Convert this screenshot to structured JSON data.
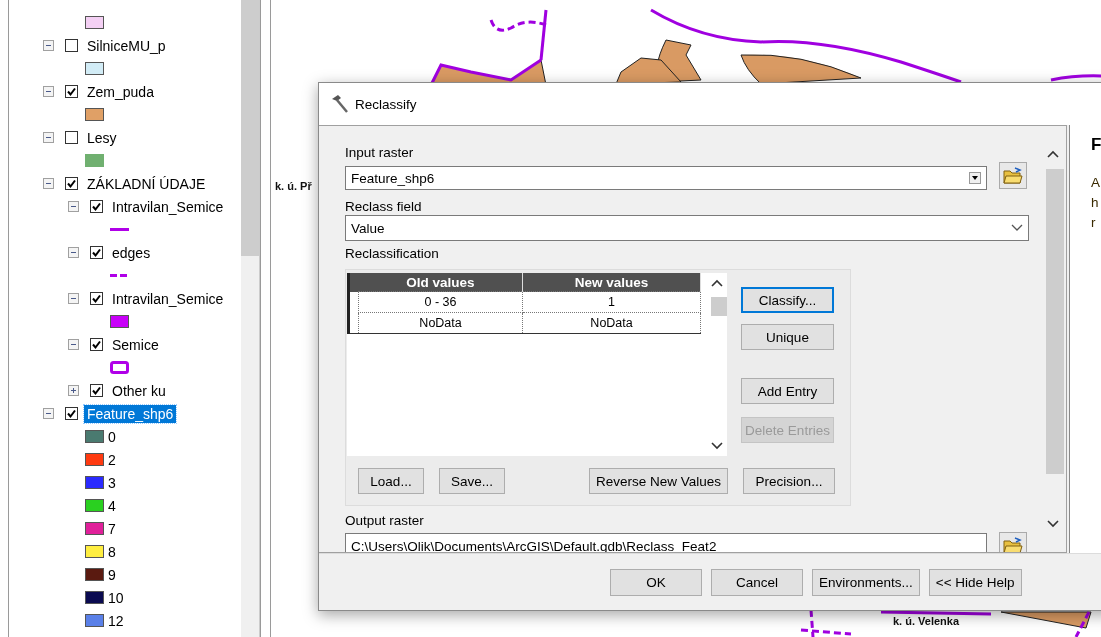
{
  "toc": {
    "top_legend": {
      "kind": "fill",
      "color": "#f4d0f4"
    },
    "layers": [
      {
        "name": "SilniceMU_p",
        "checked": false,
        "expanded": true,
        "selected": false,
        "symbol": {
          "kind": "fill",
          "color": "#d2ecf6"
        }
      },
      {
        "name": "Zem_puda",
        "checked": true,
        "expanded": true,
        "selected": false,
        "symbol": {
          "kind": "fill",
          "color": "#e0a066"
        }
      },
      {
        "name": "Lesy",
        "checked": false,
        "expanded": true,
        "selected": false,
        "symbol": {
          "kind": "flat",
          "color": "#70b070"
        }
      },
      {
        "name": "ZÁKLADNÍ ÚDAJE",
        "checked": true,
        "expanded": true,
        "selected": false,
        "children": [
          {
            "name": "Intravilan_Semice",
            "checked": true,
            "expanded": true,
            "selected": false,
            "symbol": {
              "kind": "line",
              "color": "#b000e8"
            }
          },
          {
            "name": "edges",
            "checked": true,
            "expanded": true,
            "selected": false,
            "symbol": {
              "kind": "dash",
              "color": "#b000e8"
            }
          },
          {
            "name": "Intravilan_Semice",
            "checked": true,
            "expanded": true,
            "selected": false,
            "symbol": {
              "kind": "fill",
              "color": "#c800f8"
            }
          },
          {
            "name": "Semice",
            "checked": true,
            "expanded": true,
            "selected": false,
            "symbol": {
              "kind": "outline",
              "color": "#b000e8"
            }
          },
          {
            "name": "Other ku",
            "checked": true,
            "expanded": false,
            "selected": false
          }
        ]
      },
      {
        "name": "Feature_shp6",
        "checked": true,
        "expanded": true,
        "selected": true,
        "classes": [
          {
            "label": "0",
            "color": "#4a7a70"
          },
          {
            "label": "2",
            "color": "#ff3a10"
          },
          {
            "label": "3",
            "color": "#2a2aff"
          },
          {
            "label": "4",
            "color": "#2ad020"
          },
          {
            "label": "7",
            "color": "#e0209a"
          },
          {
            "label": "8",
            "color": "#ffee40"
          },
          {
            "label": "9",
            "color": "#5a1a10"
          },
          {
            "label": "10",
            "color": "#0a0a50"
          },
          {
            "label": "12",
            "color": "#5a80e8"
          }
        ]
      }
    ]
  },
  "map": {
    "labels": [
      {
        "text": "k. ú. Př"
      },
      {
        "text": "k. ú. Velenka"
      }
    ]
  },
  "dialog": {
    "title": "Reclassify",
    "input_raster": {
      "label": "Input raster",
      "value": "Feature_shp6"
    },
    "reclass_field": {
      "label": "Reclass field",
      "value": "Value"
    },
    "reclassification": {
      "label": "Reclassification",
      "columns": [
        "Old values",
        "New values"
      ],
      "rows": [
        [
          "0 - 36",
          "1"
        ],
        [
          "NoData",
          "NoData"
        ]
      ],
      "side_buttons": [
        {
          "label": "Classify...",
          "focused": true,
          "disabled": false
        },
        {
          "label": "Unique",
          "focused": false,
          "disabled": false
        },
        {
          "label": "Add Entry",
          "focused": false,
          "disabled": false
        },
        {
          "label": "Delete Entries",
          "focused": false,
          "disabled": true
        }
      ],
      "bottom_buttons": [
        "Load...",
        "Save...",
        "Reverse New Values",
        "Precision..."
      ]
    },
    "output_raster": {
      "label": "Output raster",
      "value": "C:\\Users\\Olik\\Documents\\ArcGIS\\Default.gdb\\Reclass_Feat2"
    },
    "buttons": [
      "OK",
      "Cancel",
      "Environments...",
      "<< Hide Help"
    ],
    "help": {
      "title": "F",
      "lines": [
        "A",
        "h",
        "r"
      ]
    }
  }
}
